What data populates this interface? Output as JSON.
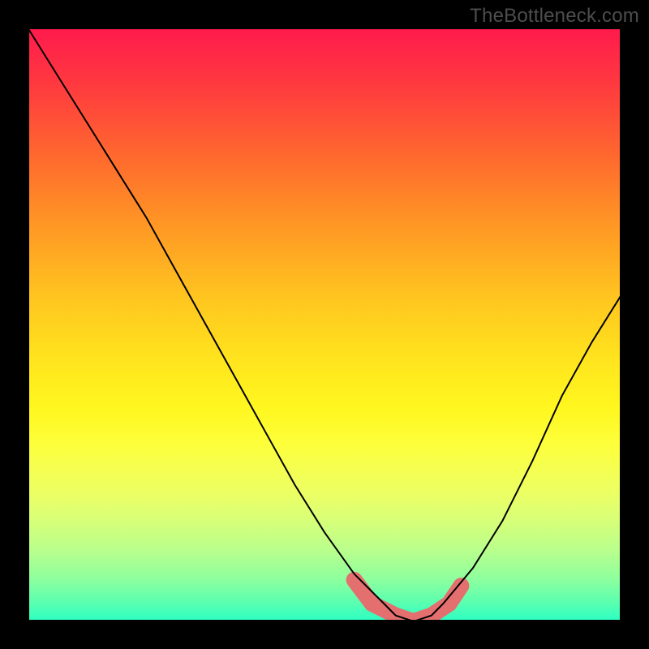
{
  "watermark": "TheBottleneck.com",
  "chart_data": {
    "type": "line",
    "title": "",
    "xlabel": "",
    "ylabel": "",
    "xlim": [
      0,
      100
    ],
    "ylim": [
      0,
      100
    ],
    "grid": false,
    "legend": false,
    "heatmap_gradient": {
      "orientation": "vertical",
      "stops": [
        {
          "pos": 0.0,
          "color": "#ff1a4d"
        },
        {
          "pos": 0.22,
          "color": "#ff6a2e"
        },
        {
          "pos": 0.46,
          "color": "#ffc71f"
        },
        {
          "pos": 0.7,
          "color": "#fdff3a"
        },
        {
          "pos": 0.88,
          "color": "#b9ff8c"
        },
        {
          "pos": 1.0,
          "color": "#2affc4"
        }
      ]
    },
    "series": [
      {
        "name": "curve",
        "color": "#000000",
        "x": [
          0,
          5,
          10,
          15,
          20,
          25,
          30,
          35,
          40,
          45,
          50,
          55,
          60,
          62,
          65,
          68,
          70,
          75,
          80,
          85,
          90,
          95,
          100
        ],
        "y": [
          100,
          92,
          84,
          76,
          68,
          59,
          50,
          41,
          32,
          23,
          15,
          8,
          3,
          1,
          0,
          1,
          3,
          9,
          17,
          27,
          38,
          47,
          55
        ]
      }
    ],
    "markers": [
      {
        "name": "bottom-segment",
        "color": "#e46f6f",
        "x": [
          55,
          58,
          62,
          65,
          68,
          71,
          73
        ],
        "y": [
          7,
          3,
          1,
          0,
          1,
          3,
          6
        ]
      }
    ]
  }
}
